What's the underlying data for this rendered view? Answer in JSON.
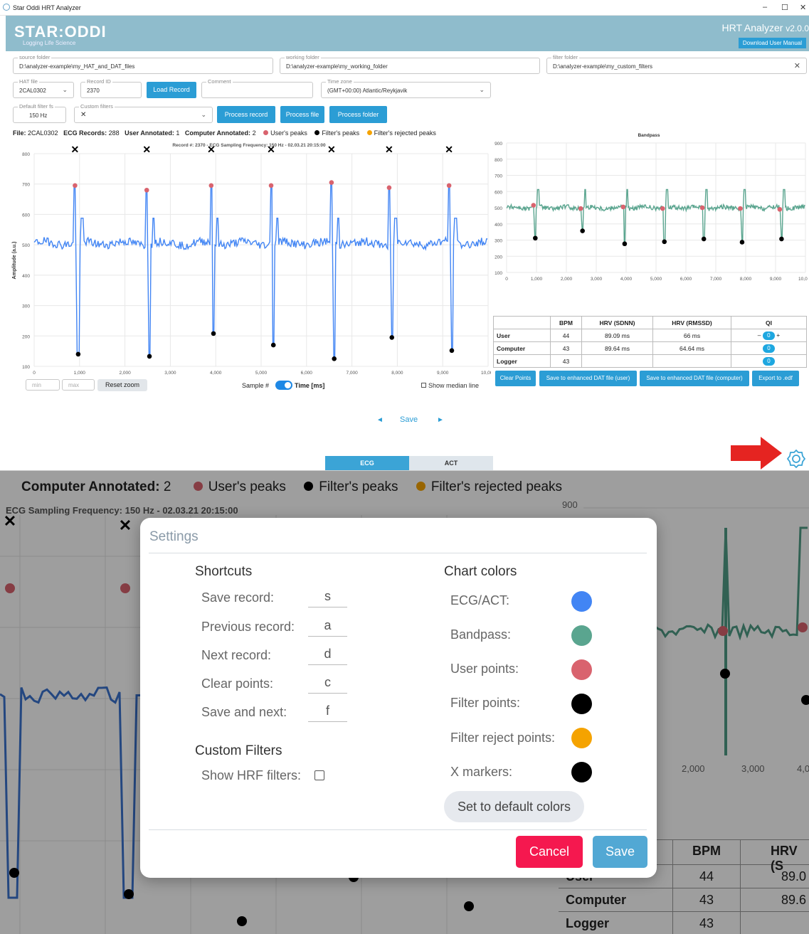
{
  "window": {
    "title": "Star Oddi HRT Analyzer",
    "controls": [
      "–",
      "☐",
      "✕"
    ]
  },
  "header": {
    "logo": "STAR:ODDI",
    "tagline": "Logging Life Science",
    "app_title": "HRT Analyzer",
    "version": "v2.0.0",
    "manual_button": "Download User Manual"
  },
  "folders": {
    "source_label": "source folder",
    "source_value": "D:\\analyzer-example\\my_HAT_and_DAT_files",
    "working_label": "working folder",
    "working_value": "D:\\analyzer-example\\my_working_folder",
    "filter_label": "filter folder",
    "filter_value": "D:\\analyzer-example\\my_custom_filters"
  },
  "controls": {
    "hat_label": "HAT file",
    "hat_value": "2CAL0302",
    "record_label": "Record ID",
    "record_value": "2370",
    "load_button": "Load Record",
    "comment_label": "Comment",
    "comment_value": "",
    "tz_label": "Time zone",
    "tz_value": "(GMT+00:00) Atlantic/Reykjavik",
    "filter_fs_label": "Default filter fs",
    "filter_fs_value": "150 Hz",
    "custom_filters_label": "Custom filters",
    "custom_filters_value": "✕",
    "process_record": "Process record",
    "process_file": "Process file",
    "process_folder": "Process folder"
  },
  "info": {
    "file_label": "File:",
    "file": "2CAL0302",
    "ecg_label": "ECG Records:",
    "ecg_records": "288",
    "user_label": "User Annotated:",
    "user_annotated": "1",
    "comp_label": "Computer Annotated:",
    "computer_annotated": "2",
    "legend_user": "User's peaks",
    "legend_filter": "Filter's peaks",
    "legend_rejected": "Filter's rejected peaks"
  },
  "colors": {
    "ecg": "#4285f4",
    "bandpass": "#5aa58f",
    "user": "#d9636e",
    "filter": "#000000",
    "rejected": "#f5a300",
    "x_markers": "#000000"
  },
  "chart_data": [
    {
      "type": "line",
      "title": "Record #: 2370  -  ECG Sampling Frequency: 150 Hz  -  02.03.21 20:15:00",
      "ylabel": "Amplitude (a.u.)",
      "xlabel": "Time [ms]",
      "xlim": [
        0,
        10000
      ],
      "ylim": [
        100,
        800
      ],
      "xticks": [
        "0",
        "1,000",
        "2,000",
        "3,000",
        "4,000",
        "5,000",
        "6,000",
        "7,000",
        "8,000",
        "9,000",
        "10,000"
      ],
      "yticks": [
        "100",
        "200",
        "300",
        "400",
        "500",
        "600",
        "700",
        "800"
      ],
      "baseline": 505,
      "user_peaks": [
        {
          "x": 900,
          "y": 695
        },
        {
          "x": 2480,
          "y": 680
        },
        {
          "x": 3900,
          "y": 695
        },
        {
          "x": 5220,
          "y": 695
        },
        {
          "x": 6550,
          "y": 705
        },
        {
          "x": 7820,
          "y": 688
        },
        {
          "x": 9140,
          "y": 695
        }
      ],
      "filter_peaks": [
        {
          "x": 970,
          "y": 140
        },
        {
          "x": 2540,
          "y": 133
        },
        {
          "x": 3950,
          "y": 208
        },
        {
          "x": 5270,
          "y": 170
        },
        {
          "x": 6610,
          "y": 125
        },
        {
          "x": 7880,
          "y": 195
        },
        {
          "x": 9200,
          "y": 152
        }
      ],
      "x_markers": [
        900,
        2480,
        3900,
        5220,
        6550,
        7820,
        9140
      ]
    },
    {
      "type": "line",
      "title": "Bandpass",
      "xlim": [
        0,
        10000
      ],
      "ylim": [
        100,
        900
      ],
      "xticks": [
        "0",
        "1,000",
        "2,000",
        "3,000",
        "4,000",
        "5,000",
        "6,000",
        "7,000",
        "8,000",
        "9,000",
        "10,000"
      ],
      "yticks": [
        "100",
        "200",
        "300",
        "400",
        "500",
        "600",
        "700",
        "800",
        "900"
      ],
      "baseline": 500,
      "user_peaks": [
        {
          "x": 900,
          "y": 515
        },
        {
          "x": 2480,
          "y": 495
        },
        {
          "x": 3900,
          "y": 505
        },
        {
          "x": 5220,
          "y": 495
        },
        {
          "x": 6550,
          "y": 500
        },
        {
          "x": 7820,
          "y": 495
        },
        {
          "x": 9140,
          "y": 490
        }
      ],
      "filter_peaks": [
        {
          "x": 960,
          "y": 312
        },
        {
          "x": 2540,
          "y": 357
        },
        {
          "x": 3950,
          "y": 277
        },
        {
          "x": 5280,
          "y": 290
        },
        {
          "x": 6600,
          "y": 307
        },
        {
          "x": 7880,
          "y": 287
        },
        {
          "x": 9200,
          "y": 307
        }
      ]
    }
  ],
  "chart_controls": {
    "min_placeholder": "min",
    "max_placeholder": "max",
    "reset_zoom": "Reset zoom",
    "sample_label": "Sample #",
    "time_label": "Time [ms]",
    "median_label": "Show median line"
  },
  "stats": {
    "headers": [
      "",
      "BPM",
      "HRV (SDNN)",
      "HRV (RMSSD)",
      "QI"
    ],
    "rows": [
      {
        "name": "User",
        "bpm": "44",
        "sdnn": "89.09 ms",
        "rmssd": "66 ms",
        "qi": "0"
      },
      {
        "name": "Computer",
        "bpm": "43",
        "sdnn": "89.64 ms",
        "rmssd": "64.64 ms",
        "qi": "0"
      },
      {
        "name": "Logger",
        "bpm": "43",
        "sdnn": "",
        "rmssd": "",
        "qi": "0"
      }
    ],
    "minus": "–",
    "plus": "+"
  },
  "actions": {
    "clear": "Clear Points",
    "save_user": "Save to enhanced DAT file (user)",
    "save_computer": "Save to enhanced DAT file (computer)",
    "export": "Export to .edf"
  },
  "nav": {
    "prev": "◄",
    "save": "Save",
    "next": "►"
  },
  "tabs": {
    "ecg": "ECG",
    "act": "ACT"
  },
  "zoom": {
    "comp_label": "Computer Annotated:",
    "comp_value": "2",
    "legend_user": "User's peaks",
    "legend_filter": "Filter's peaks",
    "legend_rejected": "Filter's rejected peaks",
    "subtitle": "ECG Sampling Frequency:  150 Hz   -   02.03.21 20:15:00",
    "y900": "900",
    "xticks": [
      "2,000",
      "3,000",
      "4,0"
    ],
    "table_headers": [
      "BPM",
      "HRV (S"
    ],
    "table_rows": [
      {
        "name": "User",
        "bpm": "44",
        "hrv": "89.0"
      },
      {
        "name": "Computer",
        "bpm": "43",
        "hrv": "89.6"
      },
      {
        "name": "Logger",
        "bpm": "43",
        "hrv": ""
      }
    ]
  },
  "settings": {
    "title": "Settings",
    "shortcuts_heading": "Shortcuts",
    "shortcuts": [
      {
        "label": "Save record:",
        "key": "s"
      },
      {
        "label": "Previous record:",
        "key": "a"
      },
      {
        "label": "Next record:",
        "key": "d"
      },
      {
        "label": "Clear points:",
        "key": "c"
      },
      {
        "label": "Save and next:",
        "key": "f"
      }
    ],
    "custom_heading": "Custom Filters",
    "show_hrf": "Show HRF filters:",
    "colors_heading": "Chart colors",
    "color_items": [
      {
        "label": "ECG/ACT:",
        "color": "#4285f4"
      },
      {
        "label": "Bandpass:",
        "color": "#5aa58f"
      },
      {
        "label": "User points:",
        "color": "#d9636e"
      },
      {
        "label": "Filter points:",
        "color": "#000000"
      },
      {
        "label": "Filter reject points:",
        "color": "#f5a300"
      },
      {
        "label": "X markers:",
        "color": "#000000"
      }
    ],
    "default_colors": "Set to default colors",
    "cancel": "Cancel",
    "save": "Save"
  }
}
